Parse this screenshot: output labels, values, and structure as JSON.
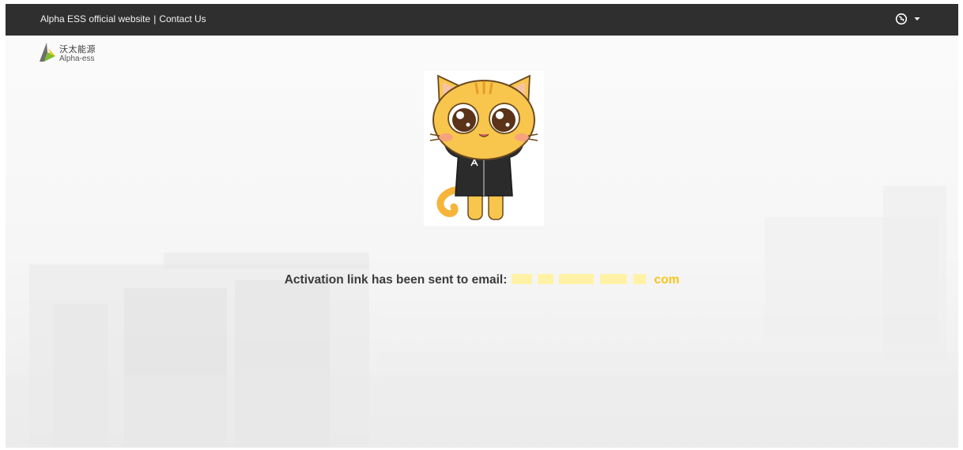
{
  "topbar": {
    "official_website_link": "Alpha ESS official website",
    "separator": "|",
    "contact_link": "Contact Us",
    "language_icon": "globe-icon",
    "dropdown_icon": "caret-down-icon"
  },
  "logo": {
    "chinese_name": "沃太能源",
    "english_name": "Alpha-ess"
  },
  "message": {
    "text": "Activation link has been sent to email:",
    "email_visible_suffix": "com"
  },
  "colors": {
    "topbar": "#2f2f2f",
    "accent_yellow": "#f5c51a",
    "logo_green": "#7bbf2a",
    "logo_grey": "#555555"
  }
}
